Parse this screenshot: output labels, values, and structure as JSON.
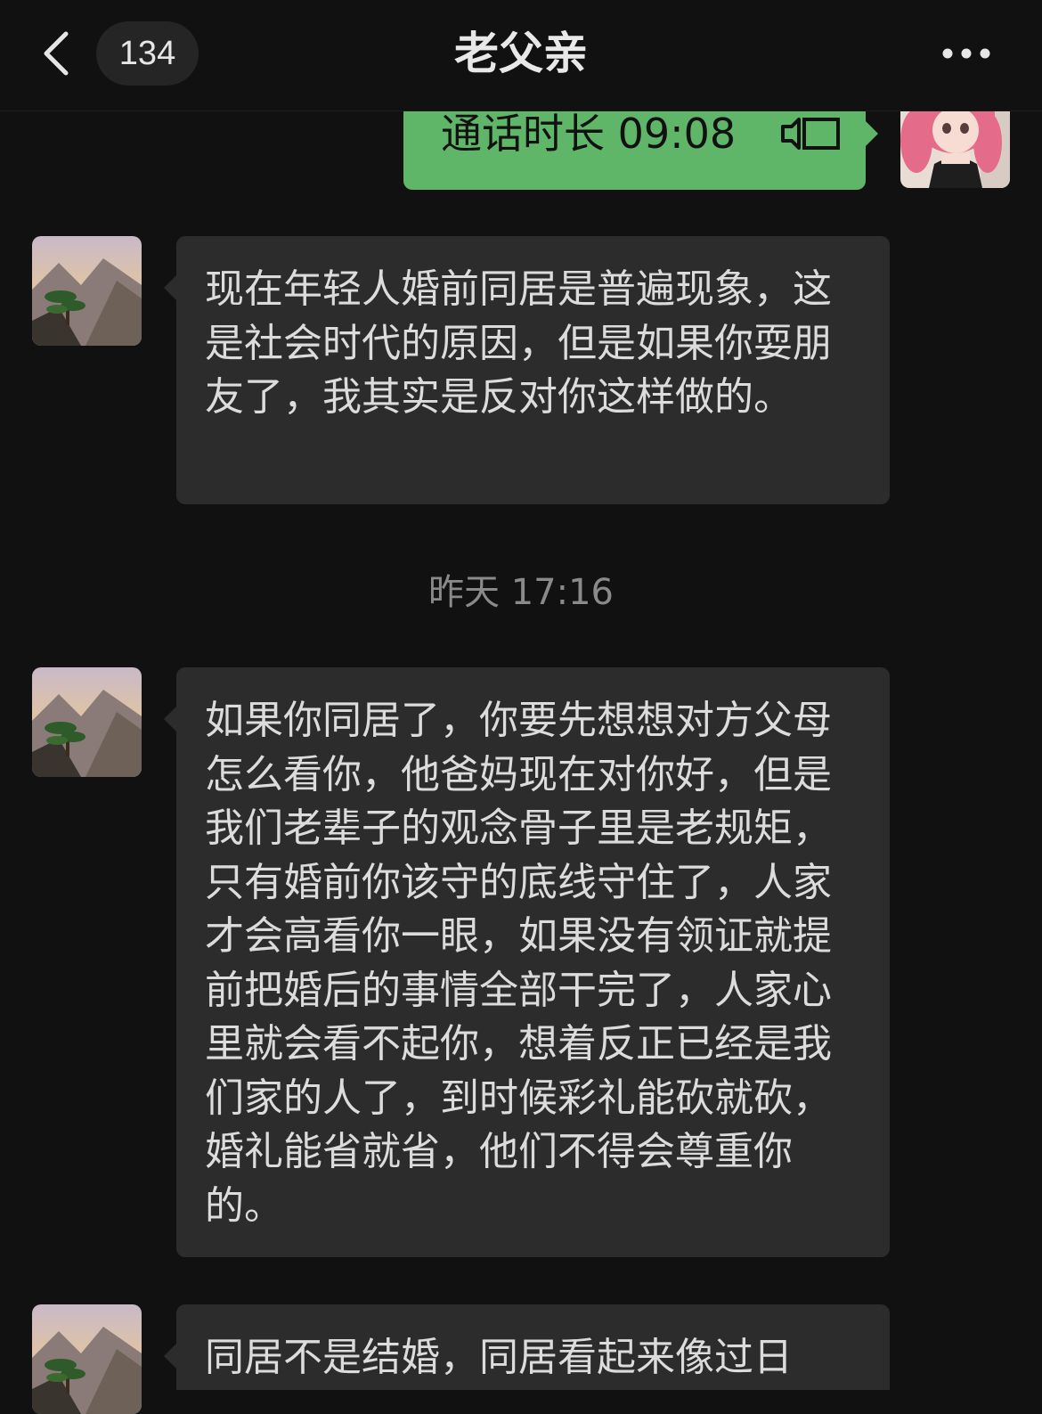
{
  "header": {
    "title": "老父亲",
    "unread_count": "134"
  },
  "call_message": {
    "text": "通话时长 09:08"
  },
  "messages": [
    {
      "text": "现在年轻人婚前同居是普遍现象，这是社会时代的原因，但是如果你耍朋友了，我其实是反对你这样做的。"
    },
    {
      "text": "如果你同居了，你要先想想对方父母怎么看你，他爸妈现在对你好，但是我们老辈子的观念骨子里是老规矩，只有婚前你该守的底线守住了，人家才会高看你一眼，如果没有领证就提前把婚后的事情全部干完了，人家心里就会看不起你，想着反正已经是我们家的人了，到时候彩礼能砍就砍，婚礼能省就省，他们不得会尊重你的。"
    },
    {
      "text": "同居不是结婚，同居看起来像过日"
    }
  ],
  "timestamp": "昨天 17:16",
  "colors": {
    "background": "#111111",
    "incoming_bubble": "#2c2c2c",
    "outgoing_bubble": "#60b668",
    "text": "#dcdcdc"
  },
  "icons": {
    "back": "chevron-left-icon",
    "more": "more-dots-icon",
    "call": "voice-call-icon"
  }
}
